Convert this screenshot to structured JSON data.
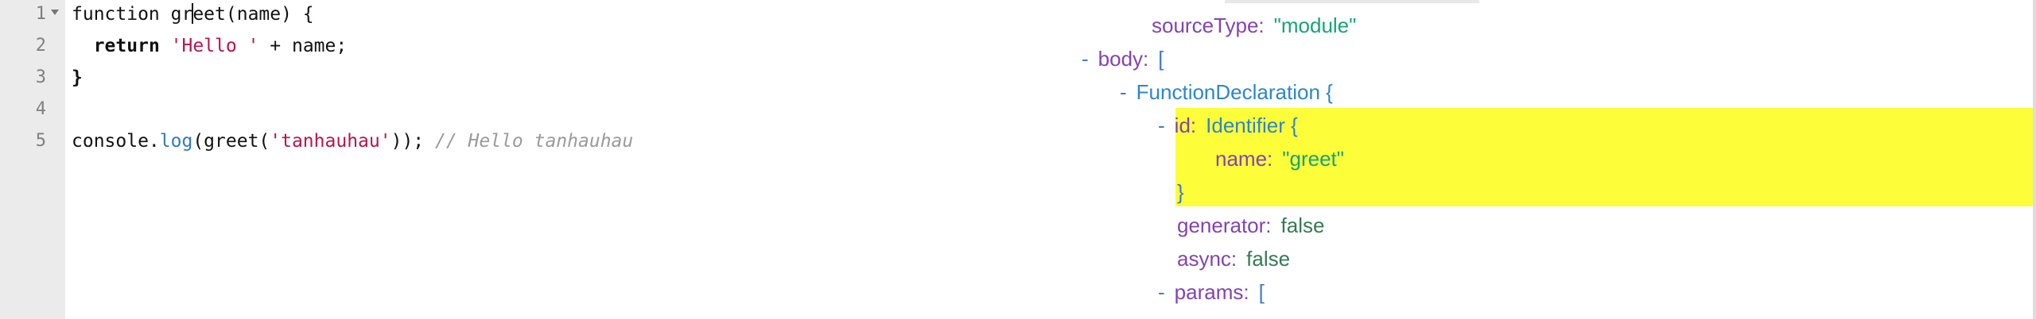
{
  "editor": {
    "line_numbers": [
      "1",
      "2",
      "3",
      "4",
      "5"
    ],
    "lines": [
      {
        "tokens": [
          {
            "t": "function gr",
            "c": "kw"
          },
          {
            "t": "CURSOR",
            "c": "cursor"
          },
          {
            "t": "eet(name) {",
            "c": "kw"
          }
        ]
      },
      {
        "tokens": [
          {
            "t": "  ",
            "c": "kw"
          },
          {
            "t": "return",
            "c": "kwb"
          },
          {
            "t": " ",
            "c": "kw"
          },
          {
            "t": "'Hello '",
            "c": "str"
          },
          {
            "t": " + name;",
            "c": "kw"
          }
        ]
      },
      {
        "tokens": [
          {
            "t": "}",
            "c": "kwb"
          }
        ]
      },
      {
        "tokens": []
      },
      {
        "tokens": [
          {
            "t": "console.",
            "c": "kw"
          },
          {
            "t": "log",
            "c": "prop"
          },
          {
            "t": "(greet(",
            "c": "kw"
          },
          {
            "t": "'tanhauhau'",
            "c": "str"
          },
          {
            "t": ")); ",
            "c": "kw"
          },
          {
            "t": "// Hello tanhauhau",
            "c": "cmt"
          }
        ]
      }
    ]
  },
  "tree": {
    "rows": [
      {
        "indent": 0,
        "toggle": "",
        "key": "sourceType:",
        "value": "\"module\"",
        "vclass": "v-str"
      },
      {
        "indent": 1,
        "toggle": "-",
        "key": "body:",
        "value": "[",
        "vclass": "brace"
      },
      {
        "indent": 2,
        "toggle": "-",
        "key": "",
        "value": "FunctionDeclaration {",
        "vclass": "type"
      },
      {
        "indent": 3,
        "toggle": "-",
        "key": "id:",
        "value": "Identifier {",
        "vclass": "type"
      },
      {
        "indent": 4,
        "toggle": "",
        "key": "name:",
        "value": "\"greet\"",
        "vclass": "v-str"
      },
      {
        "indent": 5,
        "toggle": "",
        "key": "",
        "value": "}",
        "vclass": "brace"
      },
      {
        "indent": 5,
        "toggle": "",
        "key": "generator:",
        "value": "false",
        "vclass": "v-bool"
      },
      {
        "indent": 5,
        "toggle": "",
        "key": "async:",
        "value": "false",
        "vclass": "v-bool"
      },
      {
        "indent": 3,
        "toggle": "-",
        "key": "params:",
        "value": "[",
        "vclass": "brace"
      }
    ]
  }
}
